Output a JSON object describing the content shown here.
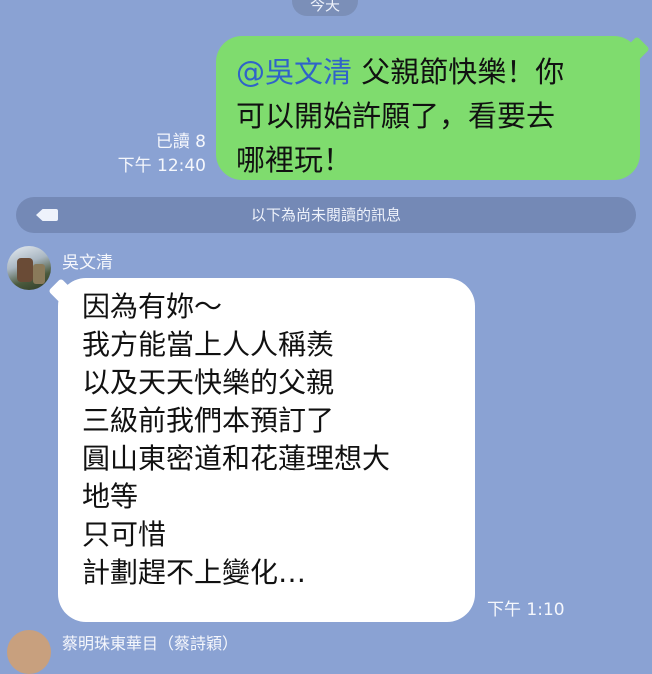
{
  "date_separator": "今天",
  "outgoing": {
    "mention": "@吳文清",
    "line1_rest": " 父親節快樂！你",
    "line2": "可以開始許願了，看要去",
    "line3": "哪裡玩！",
    "read_status": "已讀 8",
    "time": "下午 12:40"
  },
  "unread_divider": "以下為尚未閱讀的訊息",
  "incoming": {
    "sender": "吳文清",
    "lines": [
      "因為有妳～",
      "我方能當上人人稱羨",
      "以及天天快樂的父親",
      "三級前我們本預訂了",
      "圓山東密道和花蓮理想大",
      "地等",
      "只可惜",
      "計劃趕不上變化…"
    ],
    "time": "下午 1:10"
  },
  "next_message": {
    "sender_partial": "蔡明珠東華目（蔡詩穎）"
  },
  "colors": {
    "background": "#8aa2d3",
    "outgoing_bubble": "#7fdc6e",
    "incoming_bubble": "#ffffff",
    "mention": "#2f63c9"
  }
}
